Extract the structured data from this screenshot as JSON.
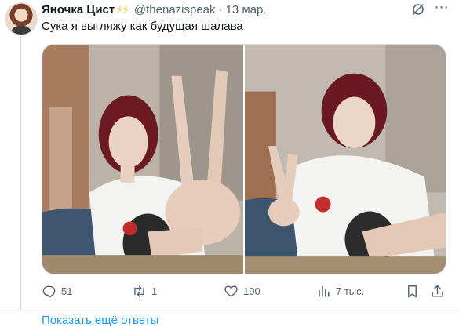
{
  "tweet": {
    "author_name": "Яночка Цист",
    "author_badge": "⚡⚡",
    "handle": "@thenazispeak",
    "separator": "·",
    "date": "13 мар.",
    "text": "Сука я выгляжу как будущая шалава",
    "media_count": 2
  },
  "actions": {
    "replies": "51",
    "reposts": "1",
    "likes": "190",
    "views": "7 тыс."
  },
  "footer": {
    "show_more_label": "Показать ещё ответы"
  },
  "colors": {
    "accent": "#1d9bf0",
    "muted": "#536471",
    "text": "#0f1419",
    "bolt": "#f2c029"
  }
}
